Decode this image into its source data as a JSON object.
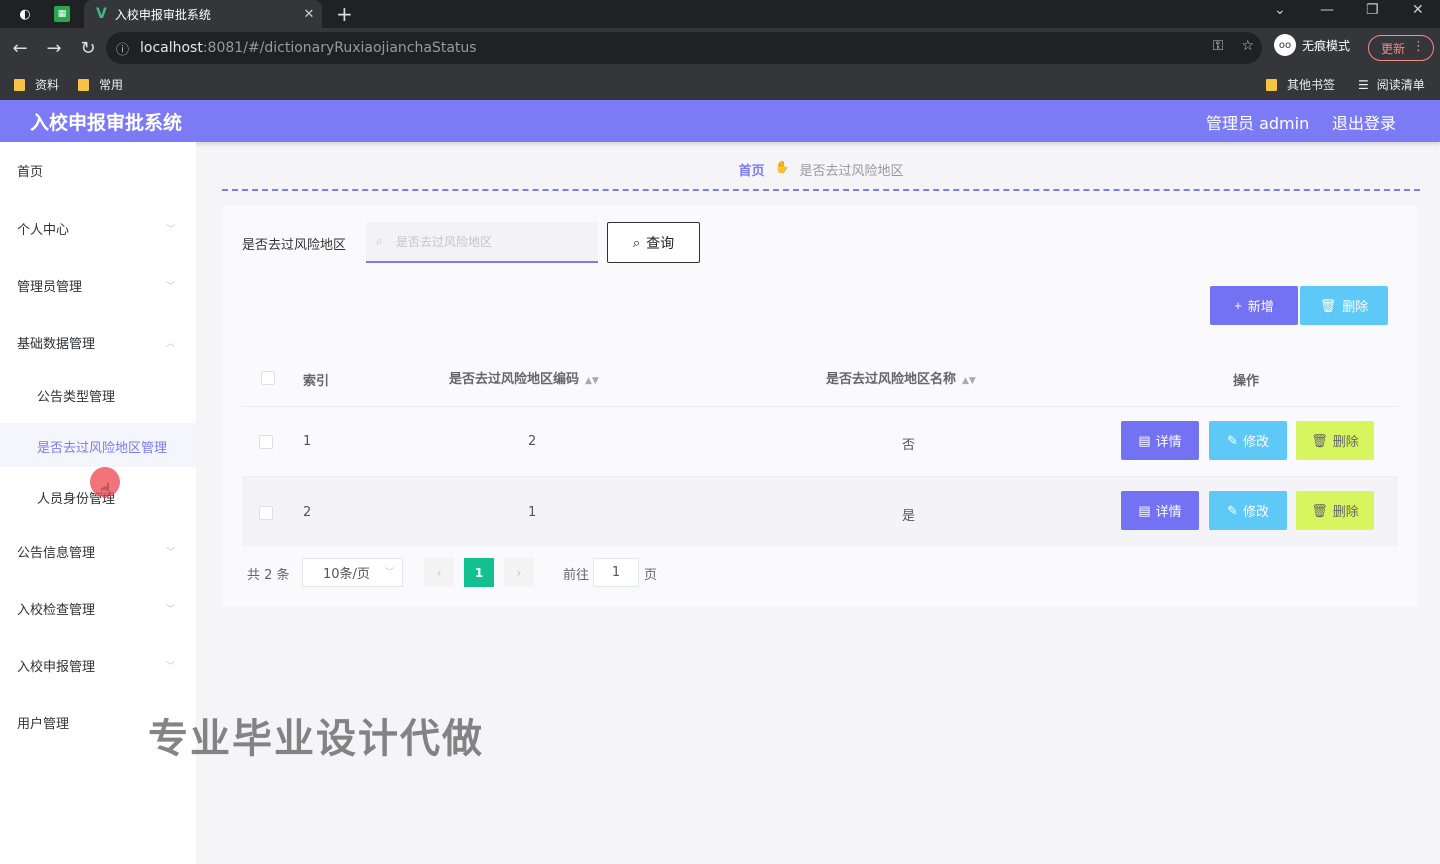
{
  "browser": {
    "tab_title": "入校申报审批系统",
    "url_host": "localhost",
    "url_rest": ":8081/#/dictionaryRuxiaojianchaStatus",
    "incognito_label": "无痕模式",
    "update_label": "更新",
    "bookmarks": [
      "资料",
      "常用"
    ],
    "other_bookmarks": "其他书签",
    "reading_list": "阅读清单"
  },
  "header": {
    "title": "入校申报审批系统",
    "user": "管理员 admin",
    "logout": "退出登录"
  },
  "sidebar": {
    "items": [
      {
        "label": "首页"
      },
      {
        "label": "个人中心"
      },
      {
        "label": "管理员管理"
      },
      {
        "label": "基础数据管理"
      },
      {
        "label": "公告信息管理"
      },
      {
        "label": "入校检查管理"
      },
      {
        "label": "入校申报管理"
      },
      {
        "label": "用户管理"
      }
    ],
    "sub_items": [
      {
        "label": "公告类型管理"
      },
      {
        "label": "是否去过风险地区管理"
      },
      {
        "label": "人员身份管理"
      }
    ]
  },
  "breadcrumb": {
    "home": "首页",
    "current": "是否去过风险地区"
  },
  "search": {
    "label": "是否去过风险地区",
    "placeholder": "是否去过风险地区",
    "query_button": "查询"
  },
  "toolbar": {
    "add_button": "新增",
    "delete_button": "删除"
  },
  "table": {
    "headers": {
      "index": "索引",
      "code": "是否去过风险地区编码",
      "name": "是否去过风险地区名称",
      "actions": "操作"
    },
    "rows": [
      {
        "index": "1",
        "code": "2",
        "name": "否"
      },
      {
        "index": "2",
        "code": "1",
        "name": "是"
      }
    ],
    "row_actions": {
      "detail": "详情",
      "edit": "修改",
      "delete": "删除"
    }
  },
  "pagination": {
    "total": "共 2 条",
    "page_size": "10条/页",
    "current_page": "1",
    "goto_prefix": "前往",
    "goto_value": "1",
    "goto_suffix": "页"
  },
  "watermark": "专业毕业设计代做",
  "colors": {
    "primary": "#7b7bf5",
    "edit": "#5ec8f7",
    "delete": "#d7f55e",
    "page_active": "#13c08f"
  }
}
